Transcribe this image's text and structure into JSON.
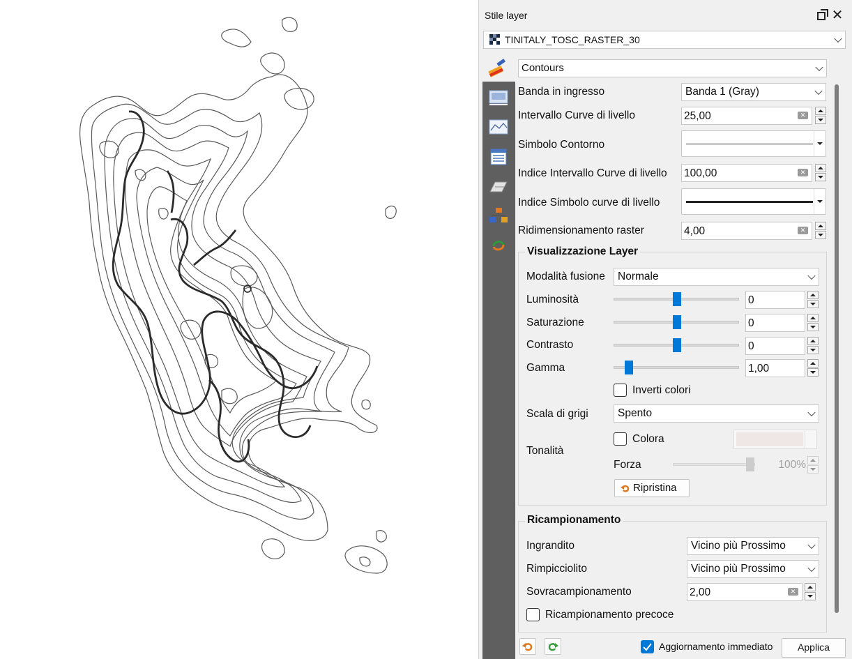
{
  "dock": {
    "title": "Stile layer",
    "layer_name": "TINITALY_TOSC_RASTER_30",
    "renderer_type": "Contours"
  },
  "contours": {
    "band_label": "Banda in ingresso",
    "band_value": "Banda 1 (Gray)",
    "interval_label": "Intervallo Curve di livello",
    "interval_value": "25,00",
    "symbol_label": "Simbolo Contorno",
    "index_interval_label": "Indice Intervallo Curve di livello",
    "index_interval_value": "100,00",
    "index_symbol_label": "Indice Simbolo curve di livello",
    "downscale_label": "Ridimensionamento raster",
    "downscale_value": "4,00"
  },
  "rendering": {
    "title": "Visualizzazione Layer",
    "blend_label": "Modalità fusione",
    "blend_value": "Normale",
    "brightness_label": "Luminosità",
    "brightness_value": "0",
    "saturation_label": "Saturazione",
    "saturation_value": "0",
    "contrast_label": "Contrasto",
    "contrast_value": "0",
    "gamma_label": "Gamma",
    "gamma_value": "1,00",
    "invert_label": "Inverti colori",
    "grayscale_label": "Scala di grigi",
    "grayscale_value": "Spento",
    "hue_label": "Tonalità",
    "colorize_label": "Colora",
    "strength_label": "Forza",
    "strength_value": "100%",
    "reset_label": "Ripristina"
  },
  "resampling": {
    "title": "Ricampionamento",
    "zoomed_in_label": "Ingrandito",
    "zoomed_in_value": "Vicino più Prossimo",
    "zoomed_out_label": "Rimpicciolito",
    "zoomed_out_value": "Vicino più Prossimo",
    "oversampling_label": "Sovracampionamento",
    "oversampling_value": "2,00",
    "early_label": "Ricampionamento precoce"
  },
  "footer": {
    "live_update_label": "Aggiornamento immediato",
    "apply_label": "Applica"
  },
  "colors": {
    "accent": "#0078d7",
    "sidebar": "#5f5f5f"
  }
}
